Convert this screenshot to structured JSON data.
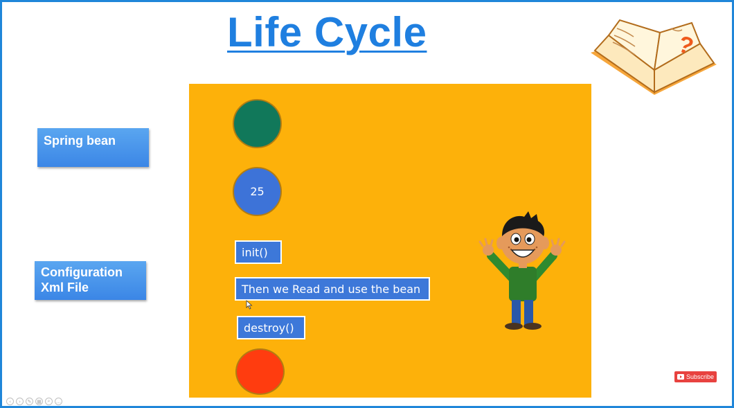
{
  "slide": {
    "title": "Life Cycle",
    "left_labels": {
      "spring_bean": "Spring bean",
      "config_file": "Configuration\nXml File"
    },
    "stage": {
      "circle_value": "25",
      "steps": {
        "init": "init()",
        "read_use": "Then we Read and use the bean",
        "destroy": "destroy()"
      }
    }
  },
  "youtube": {
    "subscribe_label": "Subscribe"
  },
  "icons": [
    "book-question-icon",
    "subscribe-play-icon",
    "cursor-icon"
  ],
  "colors": {
    "frame": "#1f86d9",
    "title": "#1f7fe0",
    "stage": "#fdb10a",
    "circle_green": "#11785a",
    "circle_blue": "#3d73d8",
    "circle_red": "#ff3c0f",
    "step_box": "#3d78d9",
    "subscribe": "#e8423f"
  }
}
